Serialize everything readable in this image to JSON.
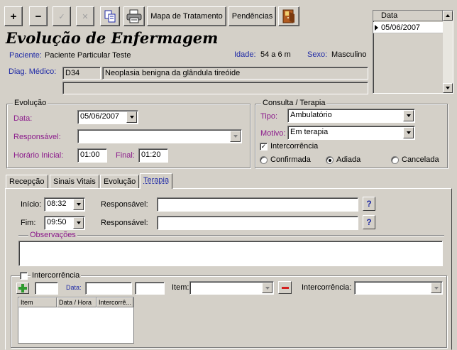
{
  "toolbar": {
    "add_symbol": "+",
    "remove_symbol": "−",
    "confirm_symbol": "✓",
    "cancel_symbol": "✕",
    "mapa_label": "Mapa de Tratamento",
    "pendencias_label": "Pendências"
  },
  "date_grid": {
    "header": "Data",
    "rows": [
      "05/06/2007"
    ]
  },
  "header": {
    "title": "Evolução de Enfermagem",
    "paciente_label": "Paciente:",
    "paciente_value": "Paciente Particular Teste",
    "idade_label": "Idade:",
    "idade_value": "54 a 6 m",
    "sexo_label": "Sexo:",
    "sexo_value": "Masculino",
    "diag_label": "Diag. Médico:",
    "diag_code": "D34",
    "diag_desc": "Neoplasia benigna da glândula tireóide"
  },
  "evolucao": {
    "group_title": "Evolução",
    "data_label": "Data:",
    "data_value": "05/06/2007",
    "responsavel_label": "Responsável:",
    "responsavel_value": "",
    "horario_label": "Horário Inicial:",
    "horario_value": "01:00",
    "final_label": "Final:",
    "final_value": "01:20"
  },
  "consulta": {
    "group_title": "Consulta / Terapia",
    "tipo_label": "Tipo:",
    "tipo_value": "Ambulatório",
    "motivo_label": "Motivo:",
    "motivo_value": "Em terapia",
    "intercorrencia_label": "Intercorrência",
    "intercorrencia_checked": true,
    "status_options": [
      "Confirmada",
      "Adiada",
      "Cancelada"
    ],
    "status_selected": "Adiada"
  },
  "tabs": [
    {
      "label": "Recepção"
    },
    {
      "label": "Sinais Vitais"
    },
    {
      "label": "Evolução"
    },
    {
      "label": "Terapia",
      "active": true
    }
  ],
  "terapia": {
    "inicio_label": "Início:",
    "inicio_value": "08:32",
    "fim_label": "Fim:",
    "fim_value": "09:50",
    "responsavel_label": "Responsável:",
    "responsavel1_value": "",
    "responsavel2_value": "",
    "help_label": "?",
    "observacoes_title": "Observações",
    "observacoes_value": "",
    "intercorrencia_title": "Intercorrência",
    "add_symbol": "+",
    "remove_symbol": "−",
    "data_label": "Data:",
    "item_label": "Item:",
    "intercorrencia_label": "Intercorrência:",
    "grid_columns": [
      "Item",
      "Data / Hora",
      "Intercorrê..."
    ]
  },
  "colors": {
    "window_bg": "#d4d0c8",
    "label_blue": "#1f2aa6",
    "label_purple": "#8b1a8b",
    "add_green": "#2e9a2e",
    "remove_red": "#d42020"
  }
}
